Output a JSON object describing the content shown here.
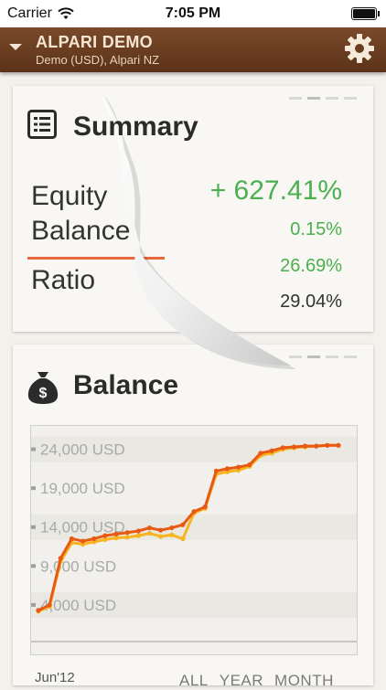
{
  "status_bar": {
    "carrier": "Carrier",
    "time": "7:05 PM"
  },
  "header": {
    "title": "ALPARI DEMO",
    "subtitle": "Demo (USD), Alpari NZ"
  },
  "summary": {
    "title": "Summary",
    "rows": [
      {
        "label": "Equity",
        "value": "+ 627.41%"
      },
      {
        "label": "Balance",
        "value": "0.15%"
      },
      {
        "label": "Ratio",
        "value": "26.69%"
      },
      {
        "label": "",
        "value": "29.04%"
      }
    ]
  },
  "balance": {
    "title": "Balance",
    "period_tabs": [
      "ALL",
      "YEAR",
      "MONTH"
    ]
  },
  "chart_data": {
    "type": "line",
    "xlabel": "",
    "ylabel": "",
    "x_tick_labels": [
      "Jun'12"
    ],
    "y_tick_labels": [
      "24,000 USD",
      "19,000 USD",
      "14,000 USD",
      "9,000 USD",
      "4,000 USD"
    ],
    "ylim": [
      0,
      27000
    ],
    "grid": true,
    "series": [
      {
        "color": "#e85a14",
        "x": [
          0,
          1,
          2,
          3,
          4,
          5,
          6,
          7,
          8,
          9,
          10,
          11,
          12,
          13,
          14,
          15,
          16,
          17,
          18,
          19,
          20,
          21,
          22,
          23,
          24,
          25,
          26,
          27
        ],
        "y": [
          3300,
          4000,
          10000,
          12500,
          12200,
          12500,
          12900,
          13100,
          13300,
          13500,
          13900,
          13600,
          13900,
          14300,
          16000,
          16600,
          21200,
          21500,
          21700,
          22000,
          23500,
          23800,
          24200,
          24300,
          24400,
          24400,
          24500,
          24500
        ]
      },
      {
        "color": "#f6b51e",
        "x": [
          0,
          1,
          2,
          3,
          4,
          5,
          6,
          7,
          8,
          9,
          10,
          11,
          12,
          13,
          14,
          15,
          16,
          17,
          18,
          19,
          20,
          21,
          22,
          23,
          24,
          25,
          26,
          27
        ],
        "y": [
          3200,
          3800,
          9600,
          12000,
          11800,
          12100,
          12400,
          12600,
          12700,
          12900,
          13200,
          12800,
          13000,
          12500,
          15800,
          16400,
          20800,
          21100,
          21300,
          21800,
          23200,
          23500,
          24000,
          24200,
          24300,
          24400,
          24500,
          24500
        ]
      }
    ]
  },
  "colors": {
    "header_brown": "#6b3d20",
    "positive_green": "#4caf50",
    "divider_orange": "#e8673c"
  }
}
